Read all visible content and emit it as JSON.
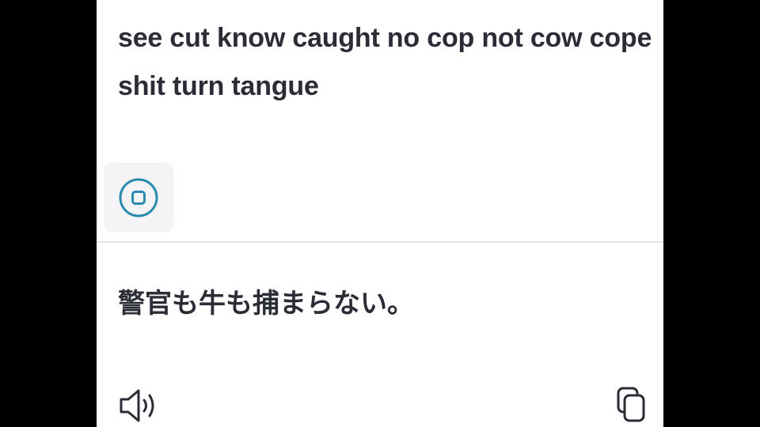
{
  "source": {
    "text": "see cut know caught no cop not cow cope shit turn tangue"
  },
  "recording": {
    "stop_icon": "stop-circle-icon"
  },
  "translation": {
    "text": "警官も牛も捕まらない。"
  },
  "actions": {
    "speak_icon": "speaker-icon",
    "copy_icon": "copy-icon"
  },
  "colors": {
    "text": "#2b2d36",
    "accent": "#2a8bb0",
    "icon": "#2b2d36",
    "button_bg": "#f4f4f6",
    "divider": "#e6e6e9"
  }
}
